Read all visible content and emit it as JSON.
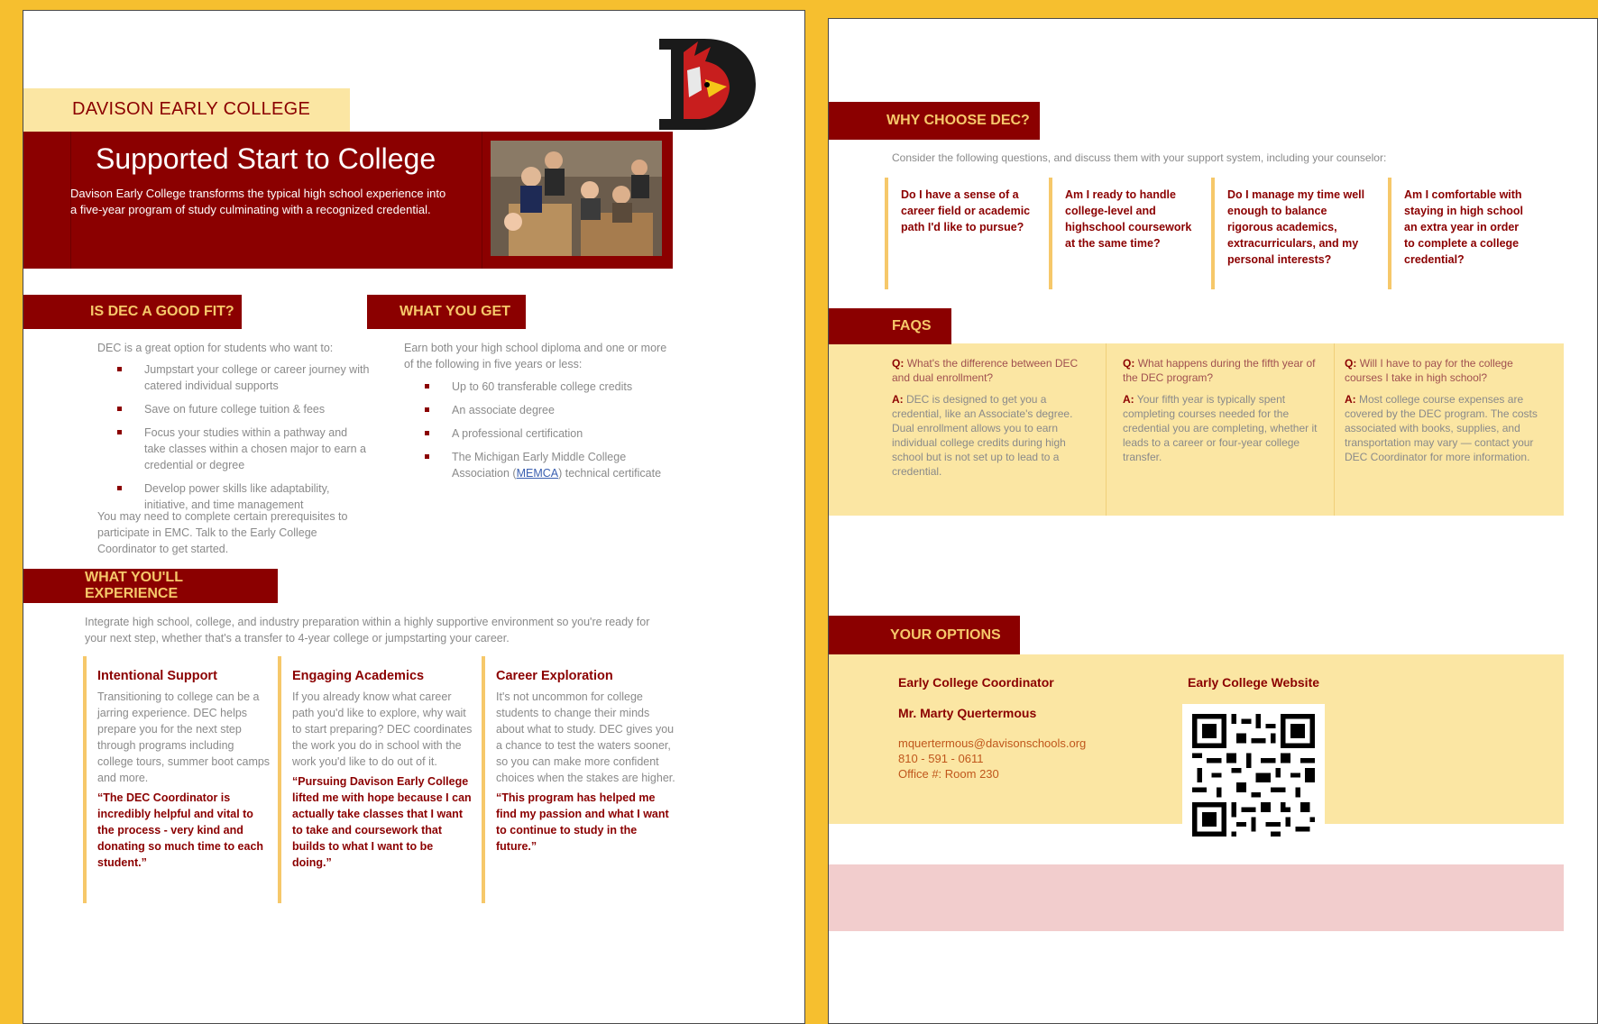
{
  "page1": {
    "school_label": "DAVISON EARLY COLLEGE",
    "hero": {
      "title": "Supported Start to College",
      "text": "Davison Early College transforms the typical high school experience into a five-year program of study culminating with a recognized credential."
    },
    "fit": {
      "heading": "IS DEC A GOOD FIT?",
      "intro": "DEC is a great option for students who want to:",
      "items": [
        "Jumpstart your college or career journey with catered individual supports",
        "Save on future college tuition & fees",
        "Focus your studies within a pathway and take classes within a chosen major to earn a credential or degree",
        "Develop power skills like adaptability, initiative, and time management"
      ],
      "outro": "You may need to complete certain prerequisites to participate in EMC. Talk to the Early College Coordinator to get started."
    },
    "get": {
      "heading": "WHAT YOU GET",
      "intro": "Earn both your high school diploma and one or more of the following in five years or less:",
      "items": [
        "Up to 60 transferable college credits",
        "An associate degree",
        "A professional certification"
      ],
      "memca_before": "The Michigan Early Middle College Association (",
      "memca_link": "MEMCA",
      "memca_after": ") technical certificate"
    },
    "experience": {
      "heading": "WHAT YOU'LL EXPERIENCE",
      "intro": "Integrate high school, college, and industry preparation within a highly supportive environment so you're ready for your next step, whether that's a transfer to 4-year college or jumpstarting your career.",
      "columns": [
        {
          "title": "Intentional Support",
          "text": "Transitioning to college can be a jarring experience. DEC helps prepare you for the next step through programs including college tours, summer boot camps and more.",
          "quote": "“The DEC Coordinator is incredibly helpful and vital to the process - very kind and donating so much time to each student.”"
        },
        {
          "title": "Engaging Academics",
          "text": "If you already know what career path you'd like to explore, why wait to start preparing? DEC coordinates the work you do in school with the work you'd like to do out of it.",
          "quote": "“Pursuing Davison Early College lifted me with hope because I can actually take classes that I want to take and coursework that builds to what I want to be doing.”"
        },
        {
          "title": "Career Exploration",
          "text": "It's not uncommon for college students to change their minds about what to study. DEC gives you a chance to test the waters sooner, so you can make more confident choices when the stakes are higher.",
          "quote": "“This program has helped me find my passion and what I want to continue to study in the future.”"
        }
      ]
    }
  },
  "page2": {
    "why": {
      "heading": "WHY CHOOSE DEC?",
      "intro": "Consider the following questions, and discuss them with your support system, including your counselor:",
      "questions": [
        "Do I have a sense of a career field or academic path I'd like to pursue?",
        "Am I ready to handle college-level and highschool coursework at the same time?",
        "Do I manage my time well enough to balance rigorous academics, extracurriculars, and my personal interests?",
        "Am I comfortable with staying in high school an extra year in order to complete a college credential?"
      ]
    },
    "faqs": {
      "heading": "FAQS",
      "q_prefix": "Q:",
      "a_prefix": "A:",
      "items": [
        {
          "q": "What's the difference between DEC and dual enrollment?",
          "a": "DEC is designed to get you a credential, like an Associate's degree. Dual enrollment allows you to earn individual college credits during high school but is not set up to lead to a credential."
        },
        {
          "q": "What happens during the fifth year of the DEC program?",
          "a": "Your fifth year is typically spent completing courses needed for the credential you are completing, whether it leads to a career or four-year college transfer."
        },
        {
          "q": "Will I have to pay for the college courses I take in high school?",
          "a": "Most college course expenses are covered by the DEC program. The costs associated with books, supplies, and transportation may vary — contact your DEC Coordinator for more information."
        }
      ]
    },
    "options": {
      "heading": "YOUR OPTIONS",
      "coordinator_label": "Early College Coordinator",
      "coordinator_name": "Mr. Marty Quertermous",
      "email": "mquertermous@davisonschools.org",
      "phone": "810 - 591 - 0611",
      "office": "Office #: Room 230",
      "website_label": "Early College Website"
    }
  },
  "colors": {
    "maroon": "#8b0000",
    "gold": "#f6c86a",
    "cream": "#fbe6a3",
    "pink": "#f2cdcd",
    "border_yellow": "#f6bf2f"
  }
}
